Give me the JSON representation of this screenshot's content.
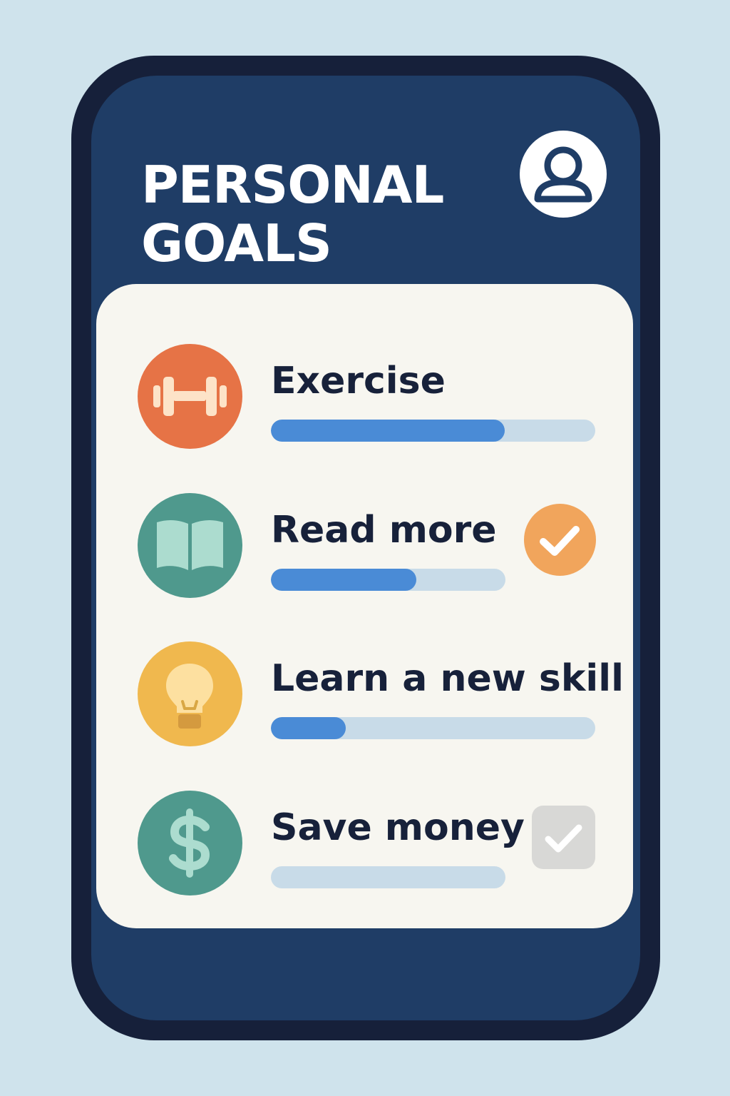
{
  "app": {
    "title": "PERSONAL GOALS",
    "profile_icon": "user-avatar-icon"
  },
  "colors": {
    "page_background": "#cfe3ec",
    "phone_frame": "#16203a",
    "screen_background": "#1f3d66",
    "card_background": "#f7f6f0",
    "progress_fill": "#4a8bd6",
    "progress_track": "#c8dbe8",
    "completed_badge": "#f1a55c",
    "empty_checkbox": "#d8d8d6"
  },
  "goals": [
    {
      "label": "Exercise",
      "icon": "dumbbell-icon",
      "icon_color": "#e67346",
      "progress": 0.72,
      "status": "none"
    },
    {
      "label": "Read more",
      "icon": "open-book-icon",
      "icon_color": "#4f998d",
      "progress": 0.62,
      "status": "completed"
    },
    {
      "label": "Learn a new skill",
      "icon": "lightbulb-icon",
      "icon_color": "#f0b84e",
      "progress": 0.23,
      "status": "none"
    },
    {
      "label": "Save money",
      "icon": "dollar-sign-icon",
      "icon_color": "#4f998d",
      "progress": 0.0,
      "status": "unchecked"
    }
  ]
}
